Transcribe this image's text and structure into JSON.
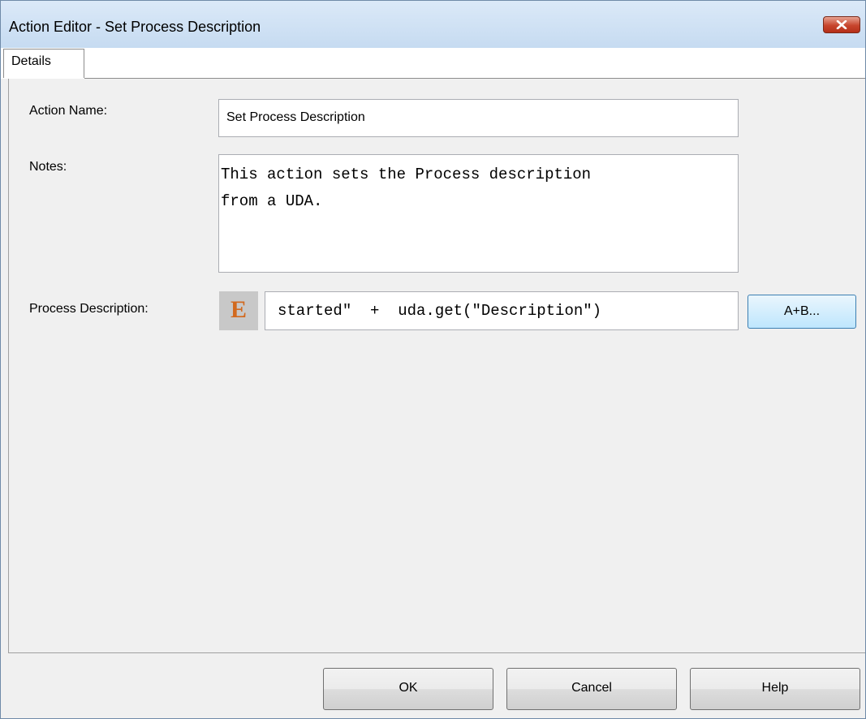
{
  "window": {
    "title": "Action Editor - Set Process Description",
    "close_icon": "close-icon"
  },
  "tabs": [
    {
      "label": "Details",
      "selected": true
    }
  ],
  "form": {
    "action_name_label": "Action Name:",
    "action_name_value": "Set Process Description",
    "notes_label": "Notes:",
    "notes_value": "This action sets the Process description\nfrom a UDA.",
    "process_description_label": "Process Description:",
    "expression_icon_letter": "E",
    "expression_icon_color": "#d2691e",
    "process_description_value": "started\"  +  uda.get(\"Description\")",
    "expression_builder_label": "A+B..."
  },
  "buttons": {
    "ok": "OK",
    "cancel": "Cancel",
    "help": "Help"
  }
}
